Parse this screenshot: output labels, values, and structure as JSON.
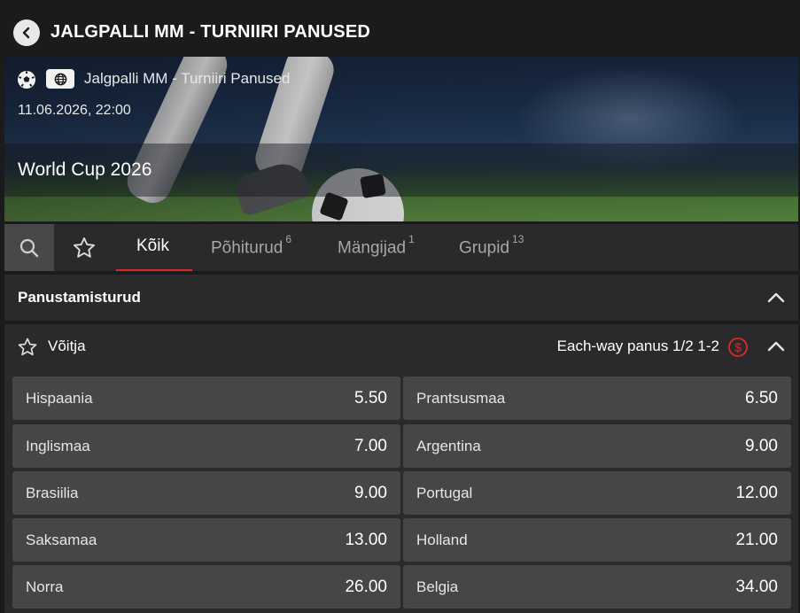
{
  "header": {
    "title": "JALGPALLI MM - TURNIIRI PANUSED",
    "back_icon": "chevron-left-icon"
  },
  "banner": {
    "breadcrumb": "Jalgpalli MM - Turniiri Panused",
    "datetime": "11.06.2026, 22:00",
    "event_name": "World Cup 2026",
    "sport_icon": "soccer-ball-icon",
    "region_icon": "globe-icon"
  },
  "tabs": {
    "items": [
      {
        "label": "Kõik",
        "count": ""
      },
      {
        "label": "Põhiturud",
        "count": "6"
      },
      {
        "label": "Mängijad",
        "count": "1"
      },
      {
        "label": "Grupid",
        "count": "13"
      }
    ],
    "active_color": "#d72a2a"
  },
  "sections": {
    "markets": {
      "title": "Panustamisturud"
    },
    "winner": {
      "title": "Võitja",
      "each_way": "Each-way panus 1/2 1-2",
      "outcomes": [
        {
          "name": "Hispaania",
          "price": "5.50"
        },
        {
          "name": "Prantsusmaa",
          "price": "6.50"
        },
        {
          "name": "Inglismaa",
          "price": "7.00"
        },
        {
          "name": "Argentina",
          "price": "9.00"
        },
        {
          "name": "Brasiilia",
          "price": "9.00"
        },
        {
          "name": "Portugal",
          "price": "12.00"
        },
        {
          "name": "Saksamaa",
          "price": "13.00"
        },
        {
          "name": "Holland",
          "price": "21.00"
        },
        {
          "name": "Norra",
          "price": "26.00"
        },
        {
          "name": "Belgia",
          "price": "34.00"
        }
      ]
    }
  }
}
